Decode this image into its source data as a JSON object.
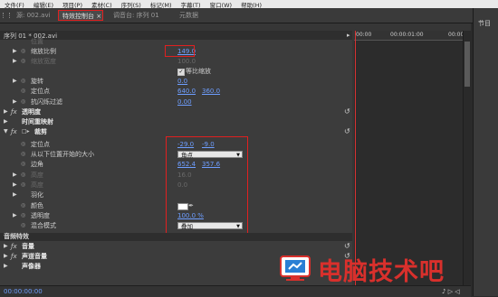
{
  "menu": [
    "文件(F)",
    "编辑(E)",
    "项目(P)",
    "素材(C)",
    "序列(S)",
    "标记(M)",
    "字幕(T)",
    "窗口(W)",
    "帮助(H)"
  ],
  "tabs": {
    "source": "源: 002.avi",
    "effect_controls": "特效控制台 ×",
    "mixer": "调音台: 序列 01",
    "metadata": "元数据"
  },
  "right_panel": {
    "label": "节目"
  },
  "sequence_header": {
    "title": "序列 01 * 002.avi",
    "arrow": "▸"
  },
  "timeline": {
    "tc_start": "00:00",
    "tc_mid": "00:00:01:00",
    "tc_end": "00:00"
  },
  "rows": {
    "position_top": {
      "label": "位置",
      "v1": "",
      "v2": ""
    },
    "scale": {
      "label": "缩放比例",
      "value": "149.0"
    },
    "scale_width": {
      "label": "缩放宽度",
      "value": "100.0"
    },
    "uniform_scale": {
      "label": "等比缩放",
      "checked": true
    },
    "rotation": {
      "label": "旋转",
      "value": "0.0"
    },
    "anchor": {
      "label": "定位点",
      "v1": "640.0",
      "v2": "360.0"
    },
    "antiflicker": {
      "label": "抗闪烁过滤",
      "value": "0.00"
    },
    "opacity_fx": {
      "label": "透明度"
    },
    "time_remap": {
      "label": "时间重映射"
    },
    "crop_fx": {
      "label": "裁剪"
    },
    "crop_anchor": {
      "label": "定位点",
      "v1": "-29.0",
      "v2": "-9.0"
    },
    "scale_from": {
      "label": "从以下位置开始的大小",
      "option": "角点"
    },
    "edge": {
      "label": "边角",
      "v1": "652.4",
      "v2": "357.6"
    },
    "height": {
      "label": "高度",
      "value": "16.0"
    },
    "height2": {
      "label": "高度",
      "value": "0.0"
    },
    "feather": {
      "label": "羽化"
    },
    "color": {
      "label": "颜色"
    },
    "opacity2": {
      "label": "透明度",
      "value": "100.0 %"
    },
    "blend": {
      "label": "混合模式",
      "option": "叠加"
    }
  },
  "audio": {
    "header": "音频特效",
    "volume": "音量",
    "channel_volume": "声道音量",
    "panner": "声像器"
  },
  "footer": {
    "timecode": "00:00:00:00"
  },
  "watermark": {
    "text": "电脑技术吧"
  },
  "colors": {
    "accent_blue": "#6e9eff",
    "highlight_red": "#e02020",
    "watermark_red": "#d9302c"
  }
}
